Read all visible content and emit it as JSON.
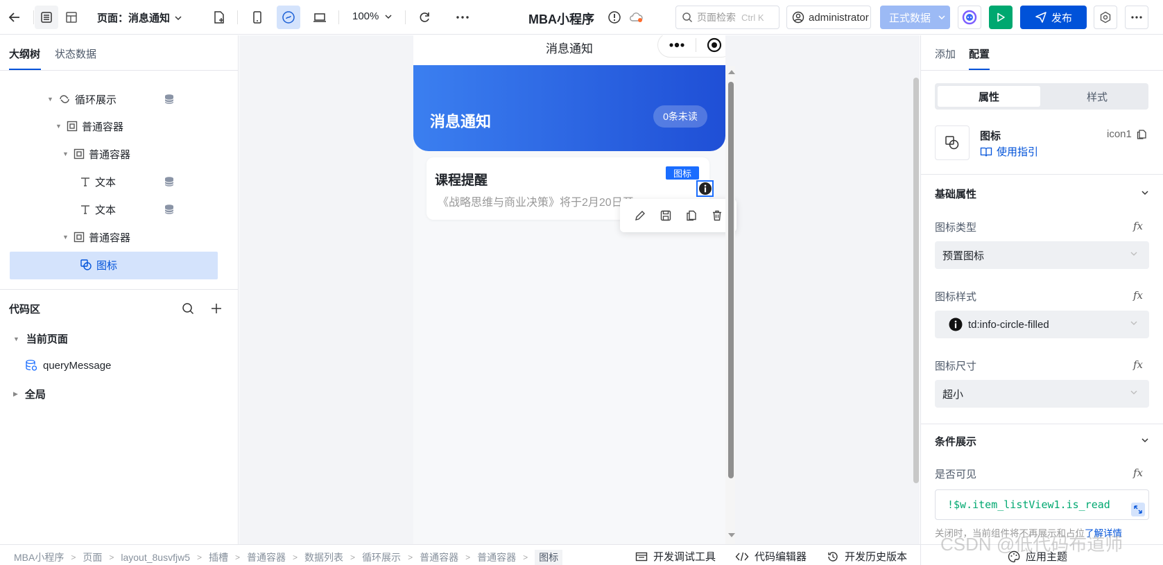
{
  "topbar": {
    "page_label": "页面：消息通知",
    "zoom": "100%",
    "app_title": "MBA小程序",
    "search_placeholder": "页面检索",
    "search_shortcut": "Ctrl K",
    "user": "administrator",
    "env": "正式数据",
    "publish": "发布"
  },
  "left": {
    "tabs": [
      "大纲树",
      "状态数据"
    ],
    "tree": [
      {
        "label": "循环展示",
        "icon": "loop-icon",
        "has_db": true
      },
      {
        "label": "普通容器",
        "icon": "container-icon",
        "has_db": false
      },
      {
        "label": "普通容器",
        "icon": "container-icon",
        "has_db": false
      },
      {
        "label": "文本",
        "icon": "text-icon",
        "has_db": true
      },
      {
        "label": "文本",
        "icon": "text-icon",
        "has_db": true
      },
      {
        "label": "普通容器",
        "icon": "container-icon",
        "has_db": false
      },
      {
        "label": "图标",
        "icon": "icon-component-icon",
        "has_db": false
      }
    ],
    "code_title": "代码区",
    "code_current": "当前页面",
    "code_query": "queryMessage",
    "code_global": "全局"
  },
  "phone": {
    "title": "消息通知",
    "banner_title": "消息通知",
    "unread": "0条未读",
    "card_title": "课程提醒",
    "card_desc": "《战略思维与商业决策》将于2月20日开",
    "selected_tag": "图标"
  },
  "right": {
    "tabs": [
      "添加",
      "配置"
    ],
    "segments": [
      "属性",
      "样式"
    ],
    "component_name": "图标",
    "component_id": "icon1",
    "guide": "使用指引",
    "section_basic": "基础属性",
    "icon_type_label": "图标类型",
    "icon_type_value": "预置图标",
    "icon_style_label": "图标样式",
    "icon_style_value": "td:info-circle-filled",
    "icon_size_label": "图标尺寸",
    "icon_size_value": "超小",
    "section_cond": "条件展示",
    "visible_label": "是否可见",
    "visible_expr": "!$w.item_listView1.is_read",
    "hint": "关闭时，当前组件将不再展示和占位",
    "hint_link": "了解详情",
    "fx": "fx"
  },
  "bottom": {
    "crumbs": [
      "MBA小程序",
      "页面",
      "layout_8usvfjw5",
      "插槽",
      "普通容器",
      "数据列表",
      "循环展示",
      "普通容器",
      "普通容器",
      "图标"
    ],
    "tools": [
      "开发调试工具",
      "代码编辑器",
      "开发历史版本",
      "应用主题"
    ],
    "watermark": "CSDN @低代码布道师"
  }
}
